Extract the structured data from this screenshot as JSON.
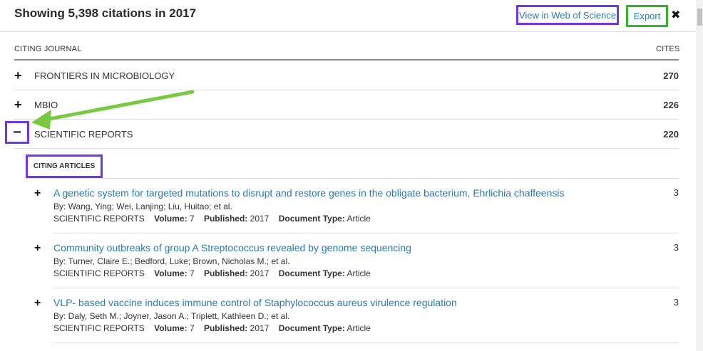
{
  "header": {
    "title": "Showing 5,398 citations in 2017",
    "view_wos": "View in Web of Science",
    "export": "Export",
    "close": "✖"
  },
  "columns": {
    "journal": "CITING JOURNAL",
    "cites": "CITES"
  },
  "journals": [
    {
      "toggle": "+",
      "name": "FRONTIERS IN MICROBIOLOGY",
      "cites": "270"
    },
    {
      "toggle": "+",
      "name": "MBIO",
      "cites": "226"
    },
    {
      "toggle": "−",
      "name": "SCIENTIFIC REPORTS",
      "cites": "220"
    }
  ],
  "subsection": {
    "label": "CITING ARTICLES"
  },
  "labels": {
    "volume": "Volume:",
    "published": "Published:",
    "doctype": "Document Type:"
  },
  "articles": [
    {
      "title": "A genetic system for targeted mutations to disrupt and restore genes in the obligate bacterium, Ehrlichia chaffeensis",
      "authors": "By: Wang, Ying; Wei, Lanjing; Liu, Huitao; et al.",
      "journal": "SCIENTIFIC REPORTS",
      "volume": "7",
      "published": "2017",
      "doctype": "Article",
      "cites": "3"
    },
    {
      "title": "Community outbreaks of group A Streptococcus revealed by genome sequencing",
      "authors": "By: Turner, Claire E.; Bedford, Luke; Brown, Nicholas M.; et al.",
      "journal": "SCIENTIFIC REPORTS",
      "volume": "7",
      "published": "2017",
      "doctype": "Article",
      "cites": "3"
    },
    {
      "title": "VLP- based vaccine induces immune control of Staphylococcus aureus virulence regulation",
      "authors": "By: Daly, Seth M.; Joyner, Jason A.; Triplett, Kathleen D.; et al.",
      "journal": "SCIENTIFIC REPORTS",
      "volume": "7",
      "published": "2017",
      "doctype": "Article",
      "cites": "3"
    }
  ],
  "colors": {
    "link": "#2a7ab0",
    "highlight_purple": "#7434e8",
    "highlight_green": "#35b22c",
    "arrow_green": "#7ac943"
  }
}
